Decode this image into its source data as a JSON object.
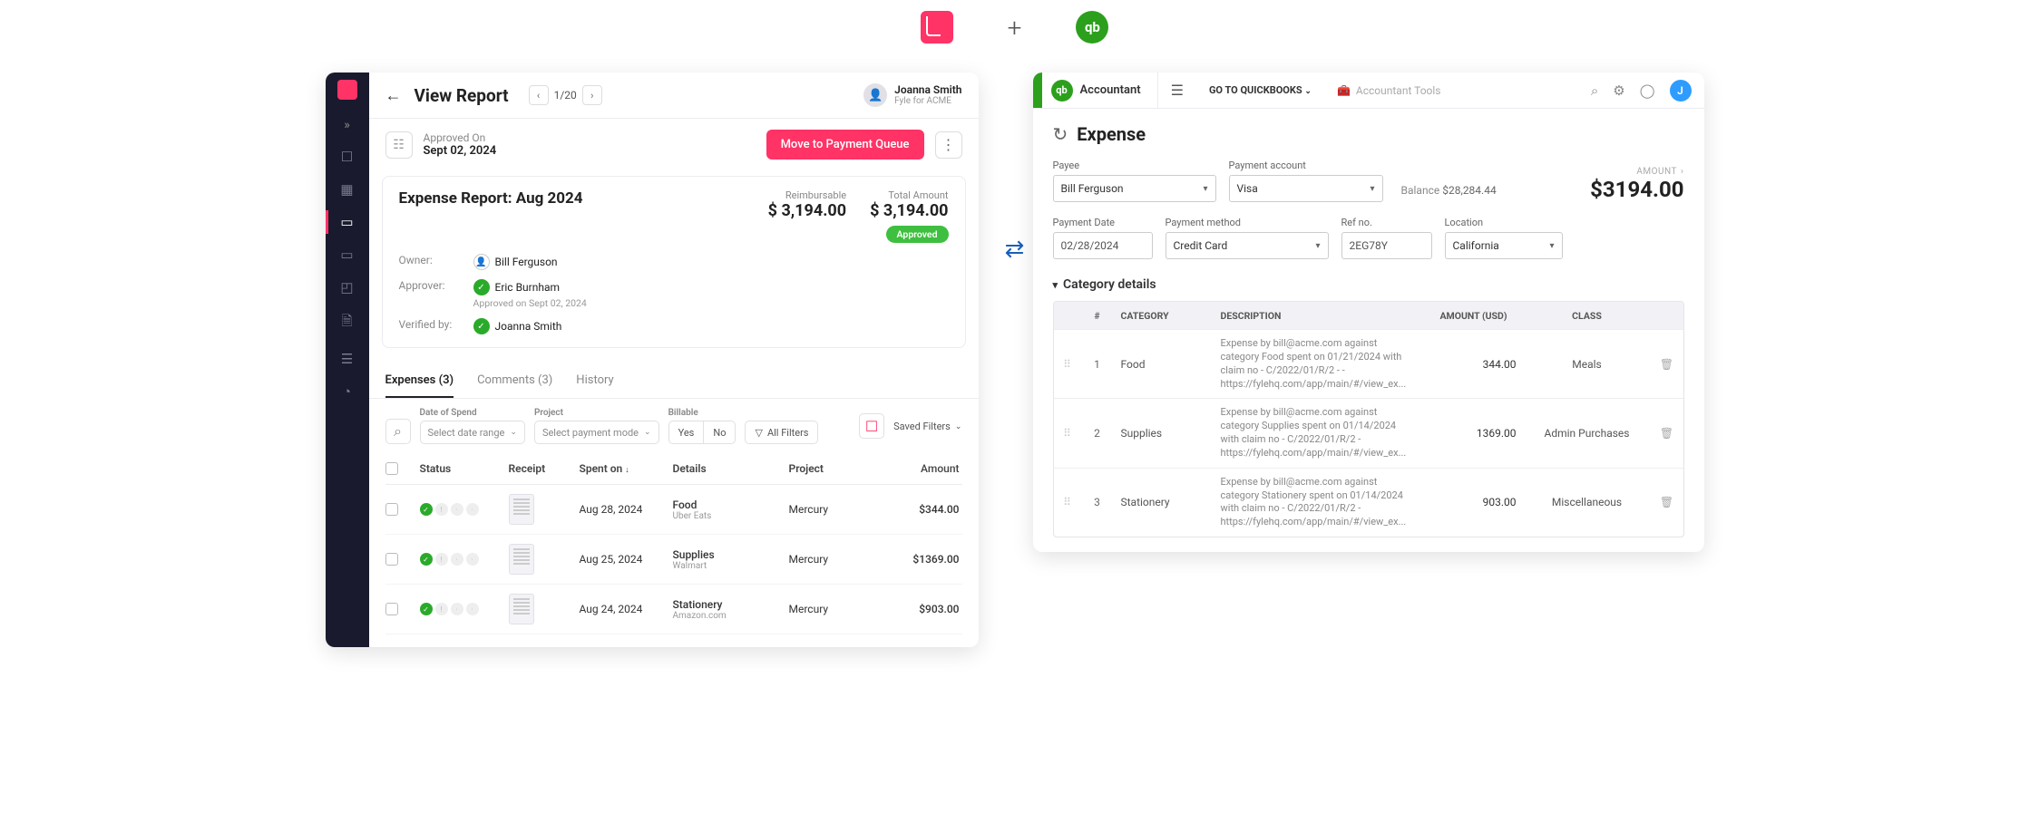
{
  "top": {
    "plus": "+",
    "qb_glyph": "qb"
  },
  "sync_glyph": "⇄",
  "fyle": {
    "header": {
      "title": "View Report",
      "pager": "1/20",
      "user_name": "Joanna Smith",
      "user_org": "Fyle for ACME"
    },
    "approved_bar": {
      "label": "Approved On",
      "date": "Sept 02, 2024",
      "move_btn": "Move to Payment Queue"
    },
    "report": {
      "title": "Expense Report: Aug 2024",
      "reimbursable_label": "Reimbursable",
      "reimbursable_value": "$ 3,194.00",
      "total_label": "Total Amount",
      "total_value": "$ 3,194.00",
      "badge": "Approved",
      "owner_label": "Owner:",
      "owner_value": "Bill Ferguson",
      "approver_label": "Approver:",
      "approver_value": "Eric Burnham",
      "approver_sub": "Approved on Sept 02, 2024",
      "verified_label": "Verified by:",
      "verified_value": "Joanna Smith"
    },
    "tabs": {
      "expenses": "Expenses (3)",
      "comments": "Comments (3)",
      "history": "History"
    },
    "filters": {
      "date_label": "Date of Spend",
      "date_placeholder": "Select date range",
      "project_label": "Project",
      "project_placeholder": "Select payment mode",
      "billable_label": "Billable",
      "yes": "Yes",
      "no": "No",
      "all_filters": "All Filters",
      "saved": "Saved Filters"
    },
    "columns": {
      "status": "Status",
      "receipt": "Receipt",
      "spent_on": "Spent on",
      "details": "Details",
      "project": "Project",
      "amount": "Amount"
    },
    "rows": [
      {
        "date": "Aug 28, 2024",
        "detail": "Food",
        "detail_sub": "Uber Eats",
        "project": "Mercury",
        "amount": "$344.00"
      },
      {
        "date": "Aug 25, 2024",
        "detail": "Supplies",
        "detail_sub": "Walmart",
        "project": "Mercury",
        "amount": "$1369.00"
      },
      {
        "date": "Aug 24, 2024",
        "detail": "Stationery",
        "detail_sub": "Amazon.com",
        "project": "Mercury",
        "amount": "$903.00"
      }
    ]
  },
  "qb": {
    "top": {
      "accountant": "Accountant",
      "goto": "GO TO QUICKBOOKS",
      "tools": "Accountant Tools",
      "avatar": "J"
    },
    "title": "Expense",
    "form": {
      "payee_label": "Payee",
      "payee_value": "Bill Ferguson",
      "acct_label": "Payment account",
      "acct_value": "Visa",
      "balance_label": "Balance",
      "balance_value": "$28,284.44",
      "amount_label": "AMOUNT",
      "amount_value": "$3194.00",
      "date_label": "Payment Date",
      "date_value": "02/28/2024",
      "method_label": "Payment method",
      "method_value": "Credit Card",
      "ref_label": "Ref no.",
      "ref_value": "2EG78Y",
      "loc_label": "Location",
      "loc_value": "California"
    },
    "cat_header": "Category details",
    "columns": {
      "num": "#",
      "category": "CATEGORY",
      "description": "DESCRIPTION",
      "amount": "AMOUNT (USD)",
      "class": "CLASS"
    },
    "rows": [
      {
        "n": "1",
        "cat": "Food",
        "desc": "Expense by bill@acme.com against category Food spent on 01/21/2024 with claim no - C/2022/01/R/2 - - https://fylehq.com/app/main/#/view_ex...",
        "amt": "344.00",
        "class": "Meals"
      },
      {
        "n": "2",
        "cat": "Supplies",
        "desc": "Expense by bill@acme.com against category Supplies spent on 01/14/2024 with claim no - C/2022/01/R/2 - https://fylehq.com/app/main/#/view_ex...",
        "amt": "1369.00",
        "class": "Admin Purchases"
      },
      {
        "n": "3",
        "cat": "Stationery",
        "desc": "Expense by bill@acme.com against category Stationery spent on 01/14/2024 with claim no - C/2022/01/R/2 - https://fylehq.com/app/main/#/view_ex...",
        "amt": "903.00",
        "class": "Miscellaneous"
      }
    ]
  }
}
